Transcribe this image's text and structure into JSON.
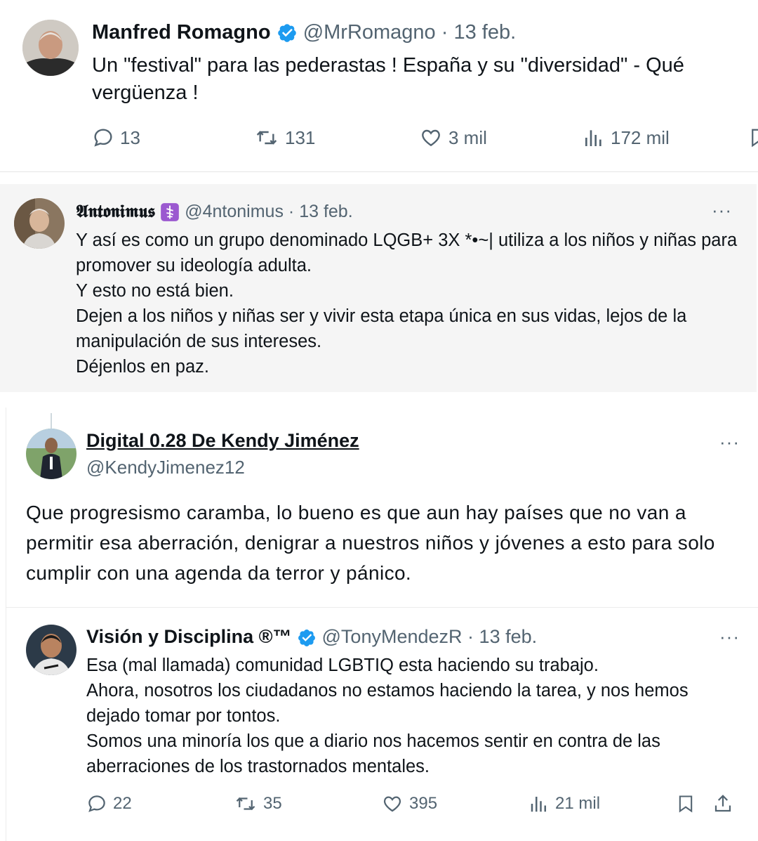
{
  "tweets": [
    {
      "name": "Manfred Romagno",
      "handle": "@MrRomagno",
      "sep": "·",
      "date": "13 feb.",
      "text": "Un \"festival\" para las pederastas !  España y su \"diversidad\" - Qué vergüenza !",
      "actions": {
        "replies": "13",
        "retweets": "131",
        "likes": "3 mil",
        "views": "172 mil"
      }
    },
    {
      "name": "𝕬𝖓𝖙𝖔𝖓𝖎𝖒𝖚𝖘",
      "handle": "@4ntonimus",
      "sep": "·",
      "date": "13 feb.",
      "lines": [
        "Y así es como un grupo denominado LQGB+ 3X *•~| utiliza a los niños y niñas para promover su ideología adulta.",
        "Y esto no está bien.",
        "Dejen a los niños y niñas ser y vivir esta etapa única en sus vidas, lejos de la manipulación de sus intereses.",
        "Déjenlos en paz."
      ]
    },
    {
      "name": "Digital 0.28 De Kendy Jiménez",
      "handle": "@KendyJimenez12",
      "text": "Que progresismo caramba, lo bueno es que aun hay países que no van a permitir esa aberración, denigrar a nuestros niños y jóvenes a esto para solo cumplir con una agenda da terror y pánico."
    },
    {
      "name": "Visión y Disciplina ®™",
      "handle": "@TonyMendezR",
      "sep": "·",
      "date": "13 feb.",
      "lines": [
        "Esa (mal llamada) comunidad LGBTIQ esta haciendo su trabajo.",
        "Ahora, nosotros los ciudadanos no estamos haciendo la tarea, y nos hemos dejado tomar por tontos.",
        "Somos una minoría los que a diario nos hacemos sentir en contra de las aberraciones de los trastornados mentales."
      ],
      "actions": {
        "replies": "22",
        "retweets": "35",
        "likes": "395",
        "views": "21 mil"
      }
    }
  ],
  "icons": [
    "reply-icon",
    "retweet-icon",
    "like-icon",
    "views-icon",
    "bookmark-icon",
    "share-icon",
    "verified-badge-icon",
    "more-icon",
    "caduceus-emoji-icon"
  ],
  "colors": {
    "verified": "#1d9bf0",
    "muted": "#536471",
    "text": "#0f1419",
    "panel": "#f5f5f5",
    "emoji_purple": "#9b59d0"
  }
}
